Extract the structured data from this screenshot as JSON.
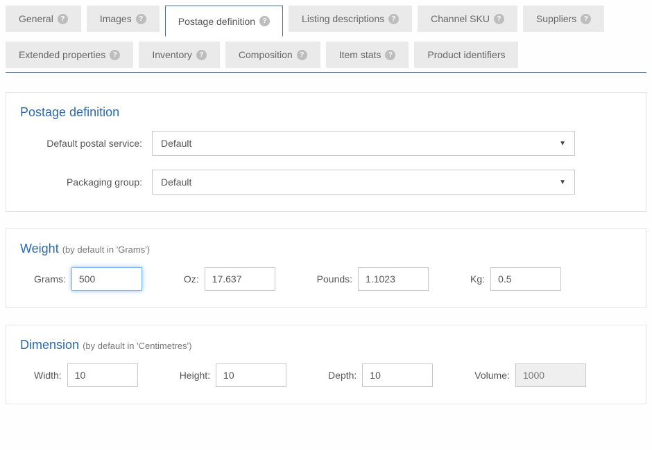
{
  "tabs": [
    {
      "label": "General",
      "help": true
    },
    {
      "label": "Images",
      "help": true
    },
    {
      "label": "Postage definition",
      "help": true,
      "active": true
    },
    {
      "label": "Listing descriptions",
      "help": true
    },
    {
      "label": "Channel SKU",
      "help": true
    },
    {
      "label": "Suppliers",
      "help": true
    },
    {
      "label": "Extended properties",
      "help": true
    },
    {
      "label": "Inventory",
      "help": true
    },
    {
      "label": "Composition",
      "help": true
    },
    {
      "label": "Item stats",
      "help": true
    },
    {
      "label": "Product identifiers",
      "help": false
    }
  ],
  "postage": {
    "title": "Postage definition",
    "postal_service_label": "Default postal service:",
    "postal_service_value": "Default",
    "packaging_group_label": "Packaging group:",
    "packaging_group_value": "Default"
  },
  "weight": {
    "title": "Weight",
    "hint": "(by default in 'Grams')",
    "grams_label": "Grams:",
    "grams_value": "500",
    "oz_label": "Oz:",
    "oz_value": "17.637",
    "pounds_label": "Pounds:",
    "pounds_value": "1.1023",
    "kg_label": "Kg:",
    "kg_value": "0.5"
  },
  "dimension": {
    "title": "Dimension",
    "hint": "(by default in 'Centimetres')",
    "width_label": "Width:",
    "width_value": "10",
    "height_label": "Height:",
    "height_value": "10",
    "depth_label": "Depth:",
    "depth_value": "10",
    "volume_label": "Volume:",
    "volume_value": "1000"
  }
}
